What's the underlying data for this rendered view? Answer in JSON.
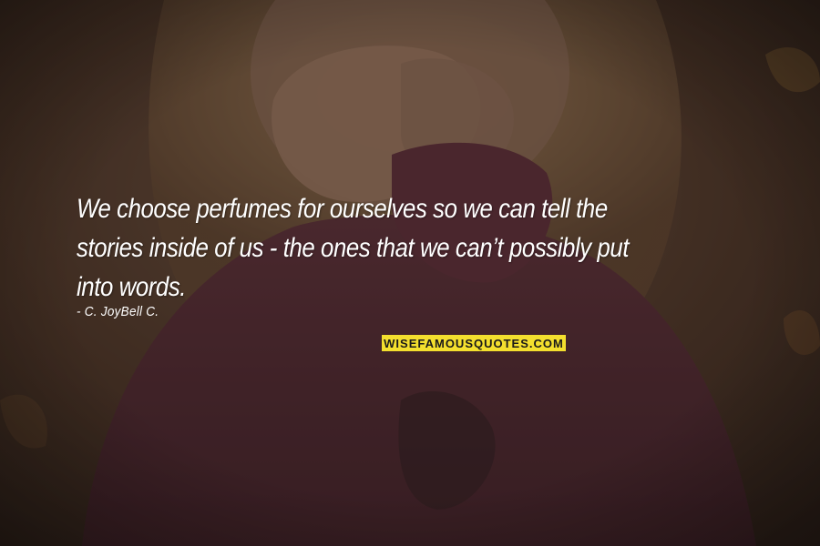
{
  "quote": {
    "lines": [
      "We choose perfumes for ourselves so we can tell the",
      "stories inside of us -  the ones that we can’t possibly put",
      "into words."
    ],
    "author": "- C. JoyBell C."
  },
  "brand": {
    "label": "WISEFAMOUSQUOTES.COM",
    "color": "#f3df2e"
  },
  "photo": {
    "description_icon": "child-covering-mouth-photo"
  }
}
